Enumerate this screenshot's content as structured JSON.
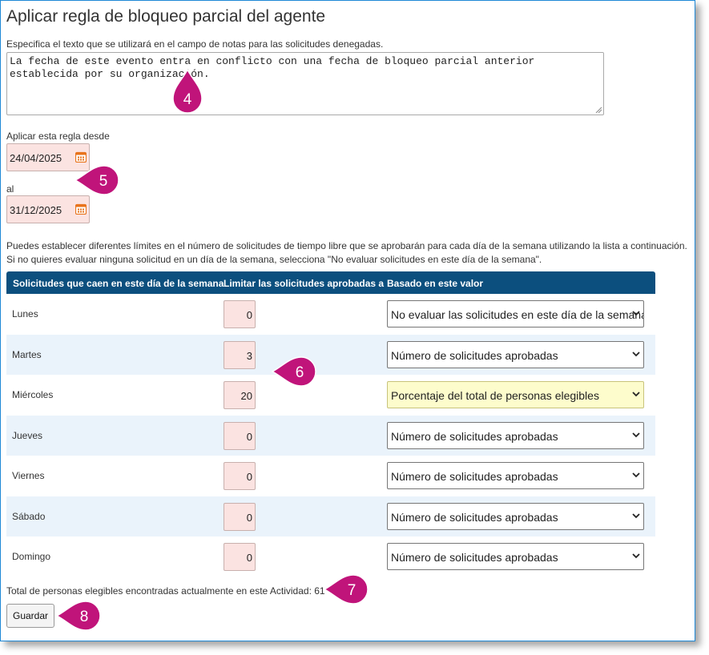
{
  "page": {
    "title": "Aplicar regla de bloqueo parcial del agente",
    "notes_label": "Especifica el texto que se utilizará en el campo de notas para las solicitudes denegadas.",
    "notes_value": "La fecha de este evento entra en conflicto con una fecha de bloqueo parcial anterior establecida por su organización.",
    "from_label": "Aplicar esta regla desde",
    "from_date": "24/04/2025",
    "to_label": "al",
    "to_date": "31/12/2025",
    "help_line1": "Puedes establecer diferentes límites en el número de solicitudes de tiempo libre que se aprobarán para cada día de la semana utilizando la lista a continuación.",
    "help_line2": "Si no quieres evaluar ninguna solicitud en un día de la semana, selecciona \"No evaluar solicitudes en este día de la semana\".",
    "total_text": "Total de personas elegibles encontradas actualmente en este Actividad: 61",
    "save_label": "Guardar"
  },
  "table": {
    "headers": [
      "Solicitudes que caen en este día de la semana",
      "Limitar las solicitudes aprobadas a",
      "Basado en este valor"
    ],
    "rows": [
      {
        "day": "Lunes",
        "limit": "0",
        "basis": "No evaluar las solicitudes en este día de la semana"
      },
      {
        "day": "Martes",
        "limit": "3",
        "basis": "Número de solicitudes aprobadas"
      },
      {
        "day": "Miércoles",
        "limit": "20",
        "basis": "Porcentaje del total de personas elegibles"
      },
      {
        "day": "Jueves",
        "limit": "0",
        "basis": "Número de solicitudes aprobadas"
      },
      {
        "day": "Viernes",
        "limit": "0",
        "basis": "Número de solicitudes aprobadas"
      },
      {
        "day": "Sábado",
        "limit": "0",
        "basis": "Número de solicitudes aprobadas"
      },
      {
        "day": "Domingo",
        "limit": "0",
        "basis": "Número de solicitudes aprobadas"
      }
    ]
  },
  "callouts": [
    "4",
    "5",
    "6",
    "7",
    "8"
  ],
  "colors": {
    "header_bg": "#0c4f7e",
    "callout": "#c0147a",
    "input_bg": "#fbe3e1",
    "highlight_select": "#fdfccc",
    "frame_border": "#1e88d6"
  },
  "icons": [
    "calendar-icon",
    "chevron-down-icon"
  ]
}
